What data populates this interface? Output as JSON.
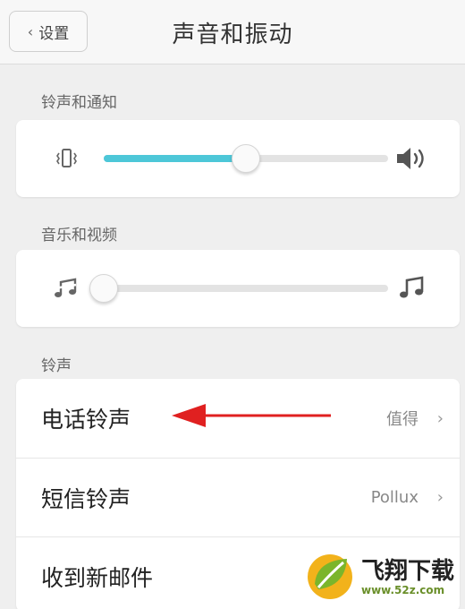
{
  "nav": {
    "back_label": "设置",
    "title": "声音和振动"
  },
  "sections": {
    "ring_notify": {
      "label": "铃声和通知",
      "slider_level": 0.5,
      "left_icon": "vibrate-icon",
      "right_icon": "speaker-volume-icon"
    },
    "music_video": {
      "label": "音乐和视频",
      "slider_level": 0.0,
      "left_icon": "music-note-muted-icon",
      "right_icon": "music-note-icon"
    },
    "ringtones": {
      "label": "铃声",
      "rows": [
        {
          "title": "电话铃声",
          "value": "值得"
        },
        {
          "title": "短信铃声",
          "value": "Pollux"
        },
        {
          "title": "收到新邮件",
          "value": ""
        }
      ]
    }
  },
  "annotation": {
    "arrow_color": "#e02020"
  },
  "watermark": {
    "title": "飞翔下载",
    "url": "www.52z.com"
  },
  "colors": {
    "accent": "#4dc7d8",
    "background": "#efefef"
  }
}
